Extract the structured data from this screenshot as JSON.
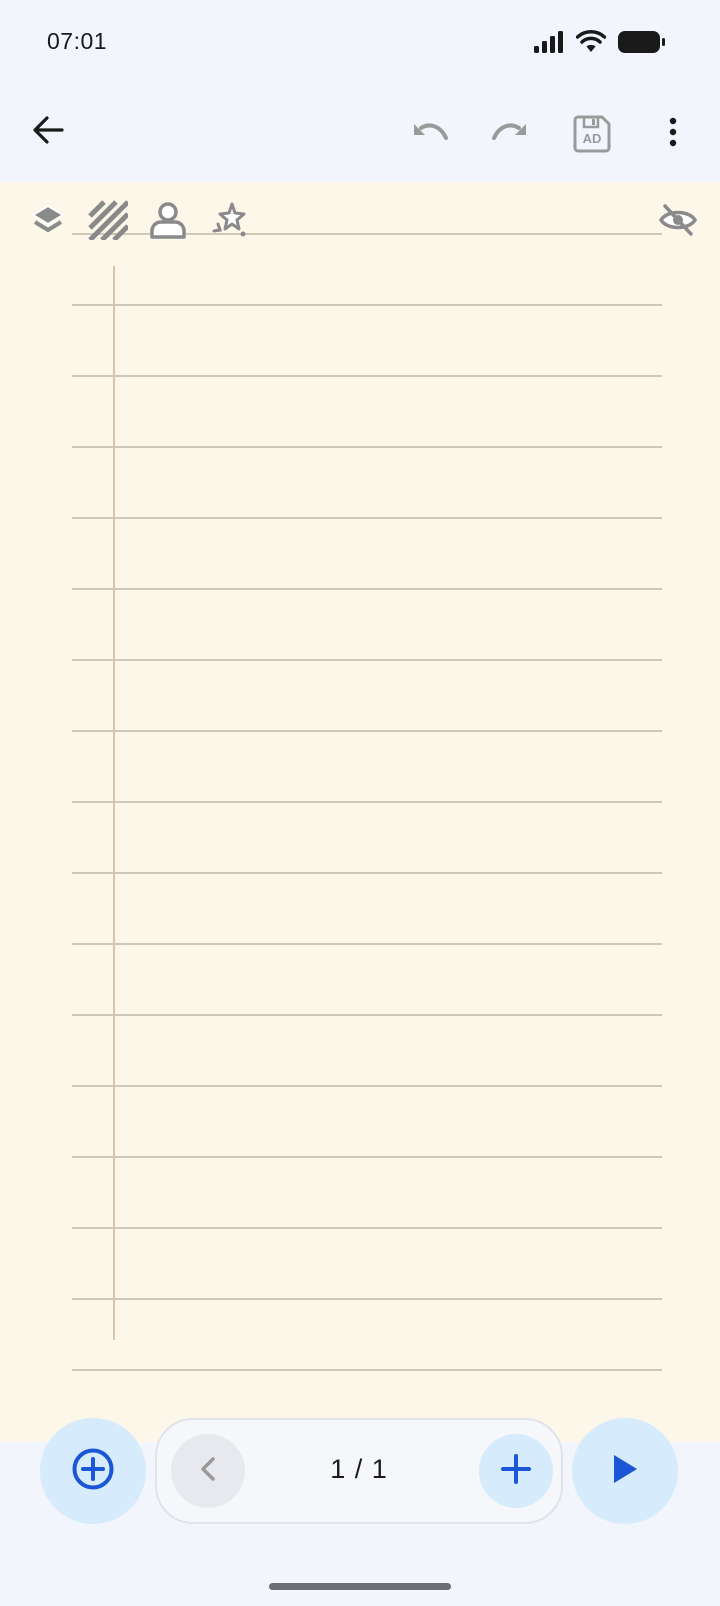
{
  "status_bar": {
    "time": "07:01",
    "icons": [
      "signal-icon",
      "wifi-icon",
      "battery-icon"
    ]
  },
  "app_bar": {
    "back_icon": "arrow-left-icon",
    "undo_icon": "undo-icon",
    "redo_icon": "redo-icon",
    "save_ad_label": "AD",
    "more_icon": "more-vertical-icon"
  },
  "paper_toolbar": {
    "tools": [
      "layers-icon",
      "hatch-pattern-icon",
      "person-outline-icon",
      "sparkle-effects-icon"
    ],
    "visibility_icon": "eye-off-icon"
  },
  "pager": {
    "current": "1 / 1"
  },
  "colors": {
    "accent": "#1a56d6",
    "fab_bg": "#d6ebfb",
    "paper": "#fdf7ea",
    "rule": "#cfc8b6",
    "margin": "#dcc4ac"
  }
}
